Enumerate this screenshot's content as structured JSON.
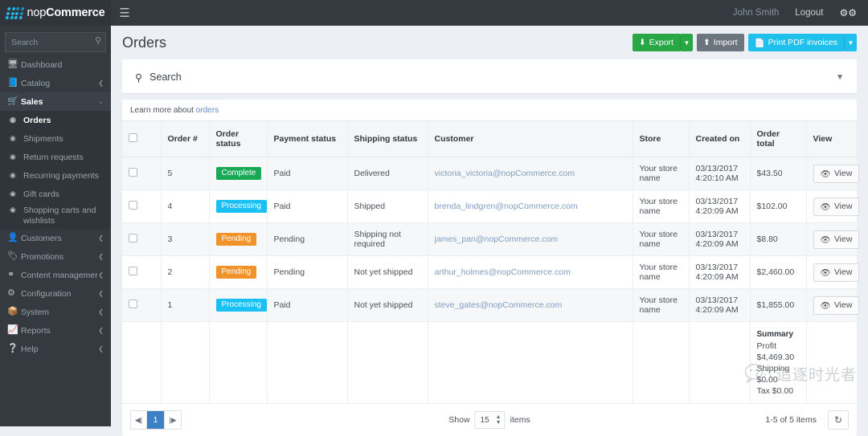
{
  "topbar": {
    "brand_prefix": "nop",
    "brand_suffix": "Commerce",
    "hamburger_icon": "hamburger-icon",
    "user_name": "John Smith",
    "logout_label": "Logout",
    "settings_icon": "gears-icon"
  },
  "sidebar": {
    "search_placeholder": "Search",
    "search_icon": "search-icon",
    "items": [
      {
        "label": "Dashboard",
        "icon": "monitor-icon",
        "arrow": "",
        "state": ""
      },
      {
        "label": "Catalog",
        "icon": "book-icon",
        "arrow": "❮",
        "state": ""
      },
      {
        "label": "Sales",
        "icon": "cart-icon",
        "arrow": "⌄",
        "state": "active"
      }
    ],
    "sales_children": [
      {
        "label": "Orders",
        "icon": "circle-dot-icon",
        "state": "current"
      },
      {
        "label": "Shipments",
        "icon": "circle-dot-icon",
        "state": ""
      },
      {
        "label": "Return requests",
        "icon": "circle-dot-icon",
        "state": ""
      },
      {
        "label": "Recurring payments",
        "icon": "circle-dot-icon",
        "state": ""
      },
      {
        "label": "Gift cards",
        "icon": "circle-dot-icon",
        "state": ""
      },
      {
        "label": "Shopping carts and wishlists",
        "icon": "circle-dot-icon",
        "state": ""
      }
    ],
    "items_bottom": [
      {
        "label": "Customers",
        "icon": "user-icon",
        "arrow": "❮"
      },
      {
        "label": "Promotions",
        "icon": "tag-icon",
        "arrow": "❮"
      },
      {
        "label": "Content management",
        "icon": "share-icon",
        "arrow": "❮"
      },
      {
        "label": "Configuration",
        "icon": "gears-icon",
        "arrow": "❮"
      },
      {
        "label": "System",
        "icon": "cube-icon",
        "arrow": "❮"
      },
      {
        "label": "Reports",
        "icon": "chart-icon",
        "arrow": "❮"
      },
      {
        "label": "Help",
        "icon": "question-icon",
        "arrow": "❮"
      }
    ]
  },
  "page": {
    "title": "Orders",
    "export_label": "Export",
    "export_icon": "download-icon",
    "import_label": "Import",
    "import_icon": "upload-icon",
    "print_label": "Print PDF invoices",
    "print_icon": "file-icon",
    "caret_icon": "caret-down-icon"
  },
  "search_panel": {
    "label": "Search",
    "icon": "search-icon",
    "collapse_icon": "chevron-down-icon"
  },
  "grid": {
    "learn_prefix": "Learn more about ",
    "learn_link": "orders",
    "columns": [
      "",
      "Order #",
      "Order status",
      "Payment status",
      "Shipping status",
      "Customer",
      "Store",
      "Created on",
      "Order total",
      "View"
    ],
    "view_label": "View",
    "view_icon": "eye-icon",
    "rows": [
      {
        "order_no": "5",
        "order_status": "Complete",
        "order_status_kind": "success",
        "payment_status": "Paid",
        "shipping_status": "Delivered",
        "customer": "victoria_victoria@nopCommerce.com",
        "store": "Your store name",
        "created_date": "03/13/2017",
        "created_time": "4:20:10 AM",
        "order_total": "$43.50"
      },
      {
        "order_no": "4",
        "order_status": "Processing",
        "order_status_kind": "info",
        "payment_status": "Paid",
        "shipping_status": "Shipped",
        "customer": "brenda_lindgren@nopCommerce.com",
        "store": "Your store name",
        "created_date": "03/13/2017",
        "created_time": "4:20:09 AM",
        "order_total": "$102.00"
      },
      {
        "order_no": "3",
        "order_status": "Pending",
        "order_status_kind": "warn",
        "payment_status": "Pending",
        "shipping_status": "Shipping not required",
        "customer": "james_pan@nopCommerce.com",
        "store": "Your store name",
        "created_date": "03/13/2017",
        "created_time": "4:20:09 AM",
        "order_total": "$8.80"
      },
      {
        "order_no": "2",
        "order_status": "Pending",
        "order_status_kind": "warn",
        "payment_status": "Pending",
        "shipping_status": "Not yet shipped",
        "customer": "arthur_holmes@nopCommerce.com",
        "store": "Your store name",
        "created_date": "03/13/2017",
        "created_time": "4:20:09 AM",
        "order_total": "$2,460.00"
      },
      {
        "order_no": "1",
        "order_status": "Processing",
        "order_status_kind": "info",
        "payment_status": "Paid",
        "shipping_status": "Not yet shipped",
        "customer": "steve_gates@nopCommerce.com",
        "store": "Your store name",
        "created_date": "03/13/2017",
        "created_time": "4:20:09 AM",
        "order_total": "$1,855.00"
      }
    ],
    "summary": {
      "title": "Summary",
      "profit_label": "Profit",
      "profit_value": "$4,469.30",
      "shipping": "Shipping $0.00",
      "tax": "Tax $0.00"
    }
  },
  "footer": {
    "prev_icon": "caret-left-icon",
    "next_icon": "caret-right-icon",
    "current_page": "1",
    "show_label": "Show",
    "page_size": "15",
    "items_label": "items",
    "items_info": "1-5 of 5 items",
    "refresh_icon": "refresh-icon"
  },
  "watermark": {
    "text": "追逐时光者",
    "icon": "wechat-icon"
  }
}
